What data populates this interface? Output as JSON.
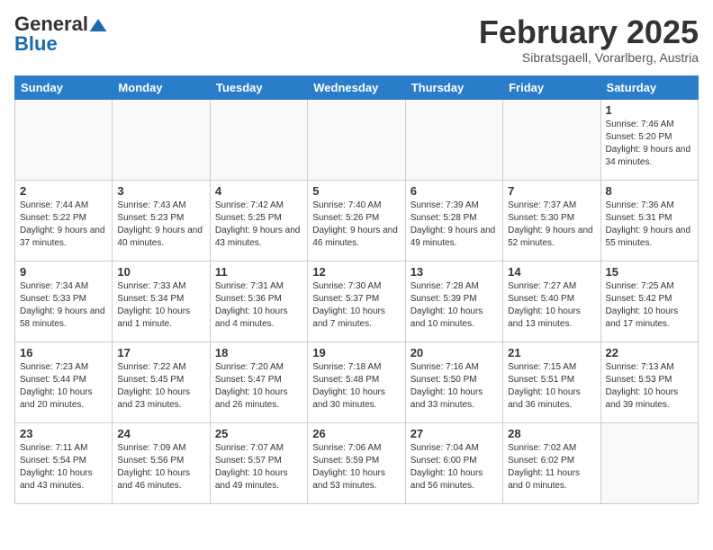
{
  "header": {
    "logo_general": "General",
    "logo_blue": "Blue",
    "month_title": "February 2025",
    "location": "Sibratsgaell, Vorarlberg, Austria"
  },
  "weekdays": [
    "Sunday",
    "Monday",
    "Tuesday",
    "Wednesday",
    "Thursday",
    "Friday",
    "Saturday"
  ],
  "weeks": [
    [
      {
        "day": "",
        "info": ""
      },
      {
        "day": "",
        "info": ""
      },
      {
        "day": "",
        "info": ""
      },
      {
        "day": "",
        "info": ""
      },
      {
        "day": "",
        "info": ""
      },
      {
        "day": "",
        "info": ""
      },
      {
        "day": "1",
        "info": "Sunrise: 7:46 AM\nSunset: 5:20 PM\nDaylight: 9 hours and 34 minutes."
      }
    ],
    [
      {
        "day": "2",
        "info": "Sunrise: 7:44 AM\nSunset: 5:22 PM\nDaylight: 9 hours and 37 minutes."
      },
      {
        "day": "3",
        "info": "Sunrise: 7:43 AM\nSunset: 5:23 PM\nDaylight: 9 hours and 40 minutes."
      },
      {
        "day": "4",
        "info": "Sunrise: 7:42 AM\nSunset: 5:25 PM\nDaylight: 9 hours and 43 minutes."
      },
      {
        "day": "5",
        "info": "Sunrise: 7:40 AM\nSunset: 5:26 PM\nDaylight: 9 hours and 46 minutes."
      },
      {
        "day": "6",
        "info": "Sunrise: 7:39 AM\nSunset: 5:28 PM\nDaylight: 9 hours and 49 minutes."
      },
      {
        "day": "7",
        "info": "Sunrise: 7:37 AM\nSunset: 5:30 PM\nDaylight: 9 hours and 52 minutes."
      },
      {
        "day": "8",
        "info": "Sunrise: 7:36 AM\nSunset: 5:31 PM\nDaylight: 9 hours and 55 minutes."
      }
    ],
    [
      {
        "day": "9",
        "info": "Sunrise: 7:34 AM\nSunset: 5:33 PM\nDaylight: 9 hours and 58 minutes."
      },
      {
        "day": "10",
        "info": "Sunrise: 7:33 AM\nSunset: 5:34 PM\nDaylight: 10 hours and 1 minute."
      },
      {
        "day": "11",
        "info": "Sunrise: 7:31 AM\nSunset: 5:36 PM\nDaylight: 10 hours and 4 minutes."
      },
      {
        "day": "12",
        "info": "Sunrise: 7:30 AM\nSunset: 5:37 PM\nDaylight: 10 hours and 7 minutes."
      },
      {
        "day": "13",
        "info": "Sunrise: 7:28 AM\nSunset: 5:39 PM\nDaylight: 10 hours and 10 minutes."
      },
      {
        "day": "14",
        "info": "Sunrise: 7:27 AM\nSunset: 5:40 PM\nDaylight: 10 hours and 13 minutes."
      },
      {
        "day": "15",
        "info": "Sunrise: 7:25 AM\nSunset: 5:42 PM\nDaylight: 10 hours and 17 minutes."
      }
    ],
    [
      {
        "day": "16",
        "info": "Sunrise: 7:23 AM\nSunset: 5:44 PM\nDaylight: 10 hours and 20 minutes."
      },
      {
        "day": "17",
        "info": "Sunrise: 7:22 AM\nSunset: 5:45 PM\nDaylight: 10 hours and 23 minutes."
      },
      {
        "day": "18",
        "info": "Sunrise: 7:20 AM\nSunset: 5:47 PM\nDaylight: 10 hours and 26 minutes."
      },
      {
        "day": "19",
        "info": "Sunrise: 7:18 AM\nSunset: 5:48 PM\nDaylight: 10 hours and 30 minutes."
      },
      {
        "day": "20",
        "info": "Sunrise: 7:16 AM\nSunset: 5:50 PM\nDaylight: 10 hours and 33 minutes."
      },
      {
        "day": "21",
        "info": "Sunrise: 7:15 AM\nSunset: 5:51 PM\nDaylight: 10 hours and 36 minutes."
      },
      {
        "day": "22",
        "info": "Sunrise: 7:13 AM\nSunset: 5:53 PM\nDaylight: 10 hours and 39 minutes."
      }
    ],
    [
      {
        "day": "23",
        "info": "Sunrise: 7:11 AM\nSunset: 5:54 PM\nDaylight: 10 hours and 43 minutes."
      },
      {
        "day": "24",
        "info": "Sunrise: 7:09 AM\nSunset: 5:56 PM\nDaylight: 10 hours and 46 minutes."
      },
      {
        "day": "25",
        "info": "Sunrise: 7:07 AM\nSunset: 5:57 PM\nDaylight: 10 hours and 49 minutes."
      },
      {
        "day": "26",
        "info": "Sunrise: 7:06 AM\nSunset: 5:59 PM\nDaylight: 10 hours and 53 minutes."
      },
      {
        "day": "27",
        "info": "Sunrise: 7:04 AM\nSunset: 6:00 PM\nDaylight: 10 hours and 56 minutes."
      },
      {
        "day": "28",
        "info": "Sunrise: 7:02 AM\nSunset: 6:02 PM\nDaylight: 11 hours and 0 minutes."
      },
      {
        "day": "",
        "info": ""
      }
    ]
  ]
}
